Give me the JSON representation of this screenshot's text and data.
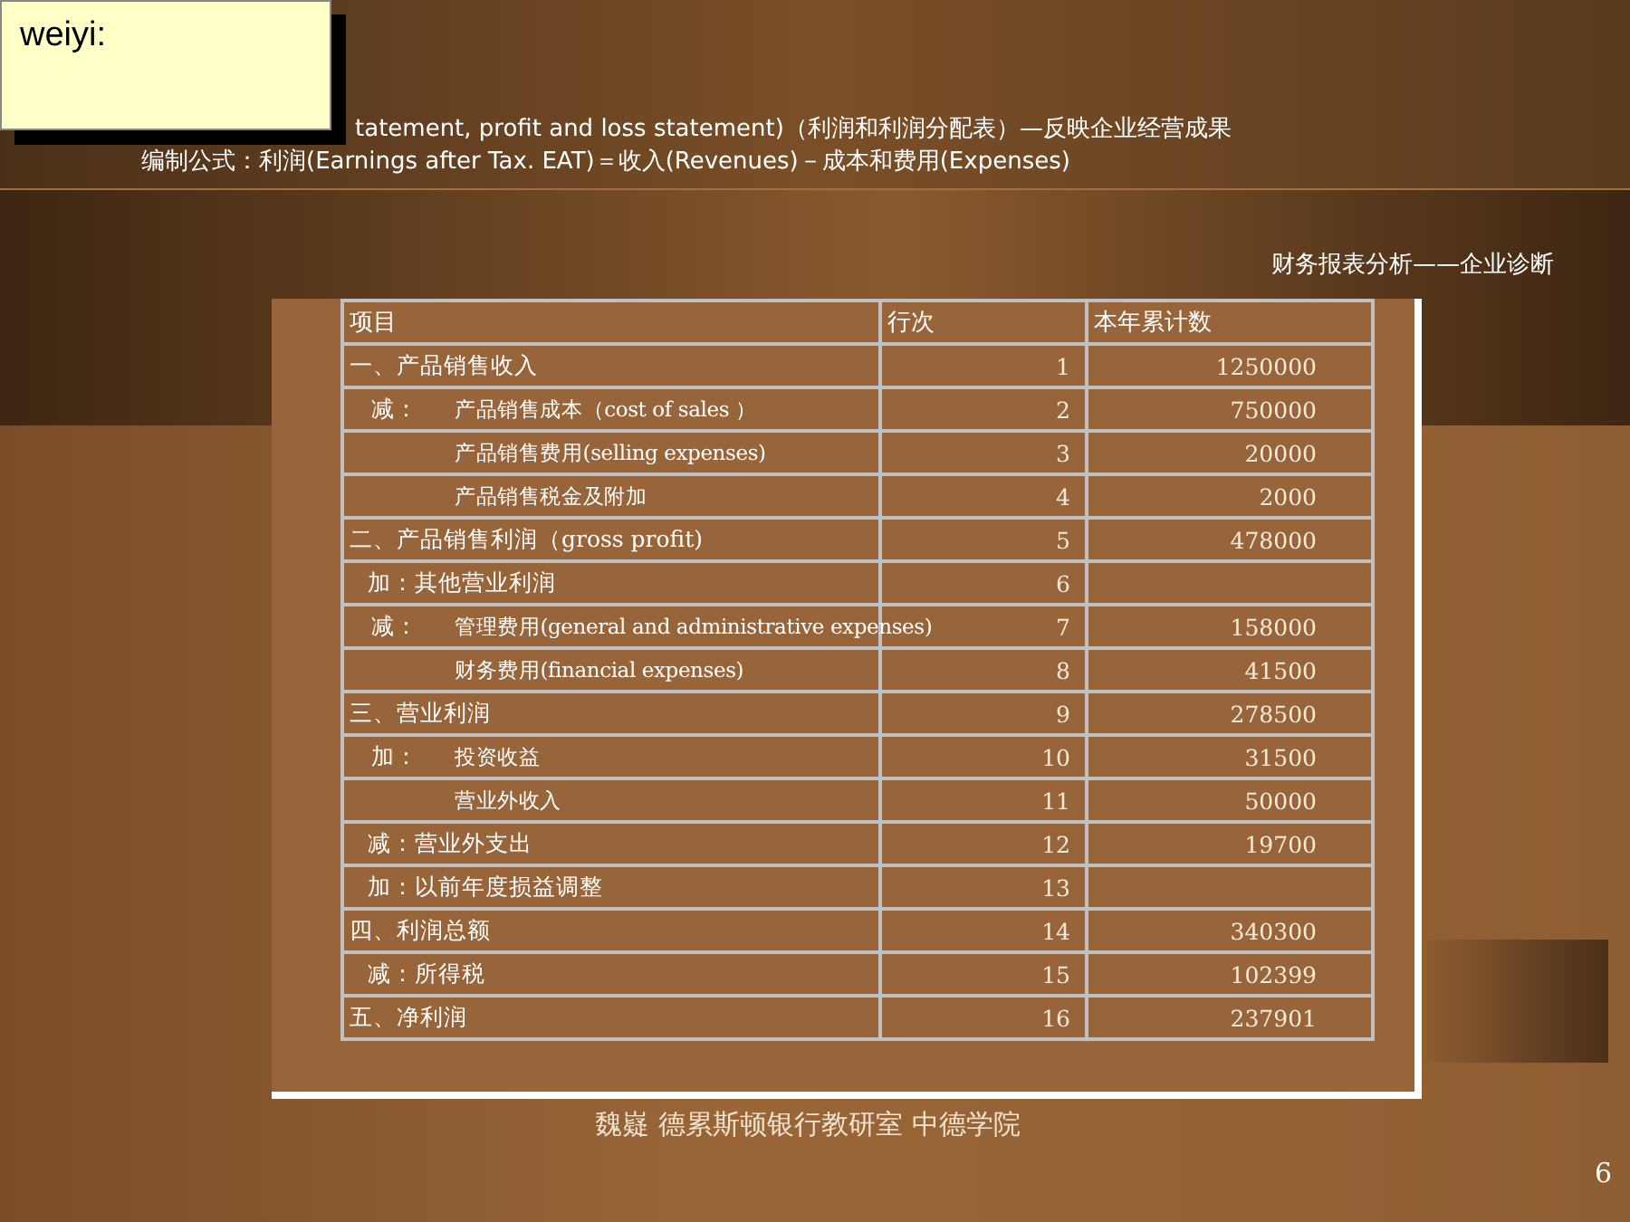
{
  "note": {
    "text": "weiyi:"
  },
  "intro": {
    "line_1": "tatement, profit and loss statement)（利润和利润分配表）—反映企业经营成果",
    "line_2": "编制公式：利润(Earnings after Tax. EAT)＝收入(Revenues)－成本和费用(Expenses)"
  },
  "subtitle": "财务报表分析——企业诊断",
  "table": {
    "columns": [
      "项目",
      "行次",
      "本年累计数"
    ],
    "rows": [
      {
        "kind": "heading",
        "item": "一、产品销售收入",
        "line": "1",
        "amount": "1250000"
      },
      {
        "kind": "detail",
        "prefix": "减：",
        "item": "产品销售成本（cost of sales ）",
        "line": "2",
        "amount": "750000"
      },
      {
        "kind": "detail",
        "item": "产品销售费用(selling expenses)",
        "line": "3",
        "amount": "20000"
      },
      {
        "kind": "detail",
        "item": "产品销售税金及附加",
        "line": "4",
        "amount": "2000"
      },
      {
        "kind": "heading",
        "item": "二、产品销售利润（gross profit)",
        "line": "5",
        "amount": "478000"
      },
      {
        "kind": "adjust",
        "item": "加：其他营业利润",
        "line": "6"
      },
      {
        "kind": "detail",
        "prefix": "减：",
        "item": "管理费用(general and administrative expenses)",
        "line": "7",
        "amount": "158000"
      },
      {
        "kind": "detail",
        "item": "财务费用(financial expenses)",
        "line": "8",
        "amount": "41500"
      },
      {
        "kind": "heading",
        "item": "三、营业利润",
        "line": "9",
        "amount": "278500"
      },
      {
        "kind": "detail",
        "prefix": "加：",
        "item": "投资收益",
        "line": "10",
        "amount": "31500"
      },
      {
        "kind": "detail",
        "item": "营业外收入",
        "line": "11",
        "amount": "50000"
      },
      {
        "kind": "adjust",
        "item": "减：营业外支出",
        "line": "12",
        "amount": "19700"
      },
      {
        "kind": "adjust",
        "item": "加：以前年度损益调整",
        "line": "13"
      },
      {
        "kind": "heading",
        "item": "四、利润总额",
        "line": "14",
        "amount": "340300"
      },
      {
        "kind": "adjust",
        "item": "减：所得税",
        "line": "15",
        "amount": "102399"
      },
      {
        "kind": "heading",
        "item": "五、净利润",
        "line": "16",
        "amount": "237901"
      }
    ]
  },
  "footer": "魏嶷 德累斯顿银行教研室 中德学院",
  "page_number": "6"
}
